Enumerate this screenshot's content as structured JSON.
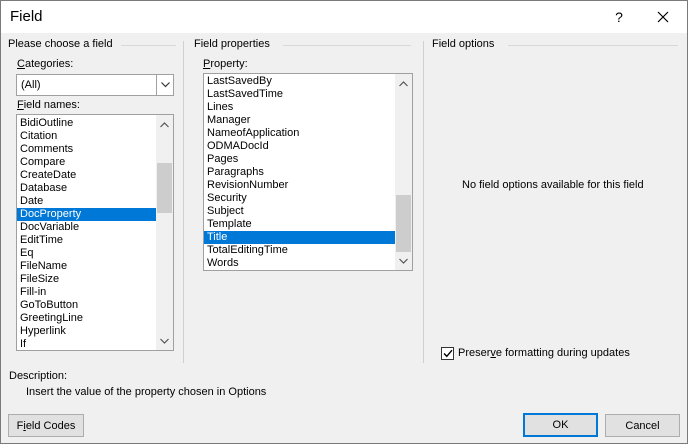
{
  "window": {
    "title": "Field",
    "help_label": "?"
  },
  "left_panel": {
    "heading": "Please choose a field",
    "categories_label_u": "C",
    "categories_label_rest": "ategories:",
    "categories_value": "(All)",
    "field_names_label_u": "F",
    "field_names_label_rest": "ield names:",
    "field_names": [
      "BidiOutline",
      "Citation",
      "Comments",
      "Compare",
      "CreateDate",
      "Database",
      "Date",
      "DocProperty",
      "DocVariable",
      "EditTime",
      "Eq",
      "FileName",
      "FileSize",
      "Fill-in",
      "GoToButton",
      "GreetingLine",
      "Hyperlink",
      "If"
    ],
    "selected_field": "DocProperty"
  },
  "middle_panel": {
    "heading": "Field properties",
    "property_label_u": "P",
    "property_label_rest": "roperty:",
    "properties": [
      "LastSavedBy",
      "LastSavedTime",
      "Lines",
      "Manager",
      "NameofApplication",
      "ODMADocId",
      "Pages",
      "Paragraphs",
      "RevisionNumber",
      "Security",
      "Subject",
      "Template",
      "Title",
      "TotalEditingTime",
      "Words"
    ],
    "selected_property": "Title"
  },
  "right_panel": {
    "heading": "Field options",
    "no_options_text": "No field options available for this field",
    "preserve_label_pre": "Preser",
    "preserve_label_u": "v",
    "preserve_label_post": "e formatting during updates",
    "preserve_checked": true
  },
  "description": {
    "label": "Description:",
    "text": "Insert the value of the property chosen in Options"
  },
  "buttons": {
    "field_codes_pre": "F",
    "field_codes_u": "i",
    "field_codes_post": "eld Codes",
    "ok": "OK",
    "cancel": "Cancel"
  }
}
